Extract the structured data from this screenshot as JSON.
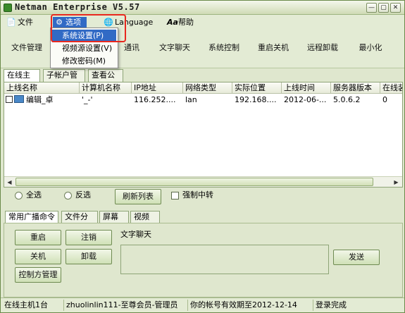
{
  "window": {
    "title": "Netman Enterprise V5.57",
    "controls": {
      "minimize": "—",
      "restore": "▢",
      "close": "✕"
    }
  },
  "menu": {
    "file": "文件",
    "options": "选项",
    "language": "Language",
    "help": "帮助"
  },
  "options_menu": {
    "items": [
      "系统设置(P)",
      "视频源设置(V)",
      "修改密码(M)"
    ]
  },
  "toolbar": {
    "buttons": [
      "文件管理",
      "通讯",
      "文字聊天",
      "系统控制",
      "重启关机",
      "远程卸载",
      "最小化"
    ]
  },
  "top_tabs": [
    "在线主机",
    "子帐户管理",
    "查看公告"
  ],
  "table": {
    "columns": [
      "上线名称",
      "计算机名称",
      "IP地址",
      "网络类型",
      "实际位置",
      "上线时间",
      "服务器版本",
      "在线装"
    ],
    "rows": [
      [
        "编辑_卓",
        "'_-'",
        "116.252....",
        "lan",
        "192.168....",
        "2012-06-...",
        "5.0.6.2",
        "0"
      ]
    ]
  },
  "options": {
    "select_all": "全选",
    "invert": "反选",
    "refresh": "刷新列表",
    "force_relay": "强制中转"
  },
  "bottom_tabs": [
    "常用广播命令",
    "文件分发",
    "屏幕墙",
    "视频墙"
  ],
  "commands": {
    "restart": "重启",
    "logoff": "注销",
    "shutdown": "关机",
    "uninstall": "卸载",
    "controller_mgmt": "控制方管理"
  },
  "chat": {
    "label": "文字聊天",
    "send": "发送"
  },
  "status": {
    "online": "在线主机1台",
    "account": "zhuolinlin111-至尊会员-管理员",
    "expiry": "你的帐号有效期至2012-12-14",
    "login": "登录完成"
  },
  "colors": {
    "window_bg": "#dfe7ce",
    "highlight": "#316ac5",
    "annotation": "#e8281f"
  }
}
